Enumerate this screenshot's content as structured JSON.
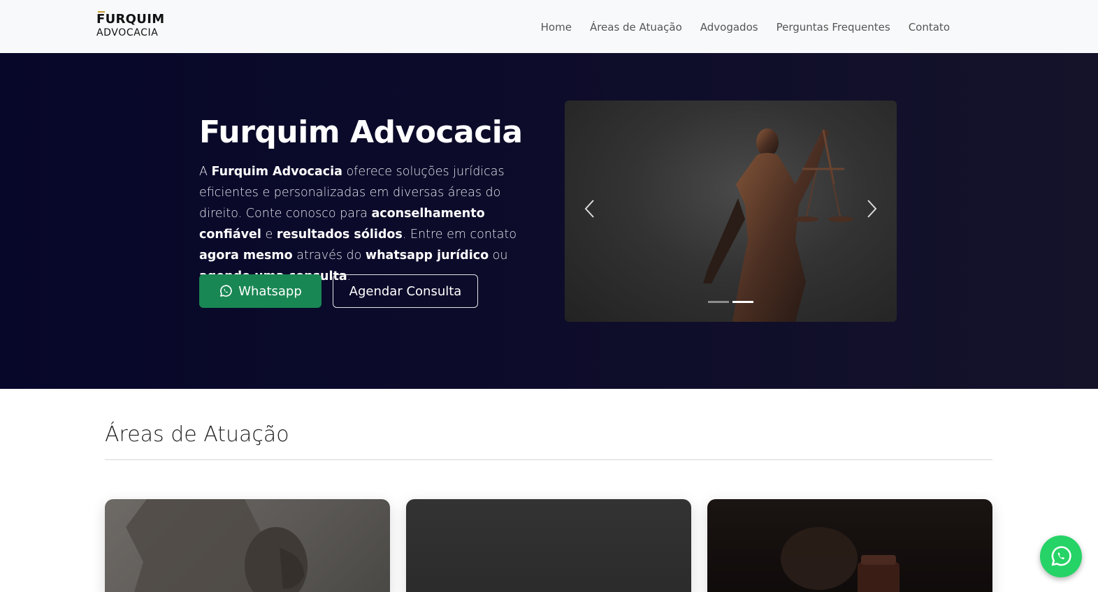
{
  "brand": {
    "line1": "FURQUIM",
    "line2": "ADVOCACIA"
  },
  "nav": {
    "items": [
      {
        "label": "Home"
      },
      {
        "label": "Áreas de Atuação"
      },
      {
        "label": "Advogados"
      },
      {
        "label": "Perguntas Frequentes"
      },
      {
        "label": "Contato"
      }
    ]
  },
  "hero": {
    "title": "Furquim Advocacia",
    "text_parts": {
      "p1": "A ",
      "b1": "Furquim Advocacia",
      "p2": " oferece soluções jurídicas eficientes e personalizadas em diversas áreas do direito. Conte conosco para ",
      "b2": "aconselhamento confiável",
      "p3": " e ",
      "b3": "resultados sólidos",
      "p4": ". Entre em contato ",
      "b4": "agora mesmo",
      "p5": " através do ",
      "b5": "whatsapp jurídico",
      "p6": " ou ",
      "b6": "agende uma consulta",
      "p7": "."
    },
    "whatsapp_label": "Whatsapp",
    "agendar_label": "Agendar Consulta"
  },
  "carousel": {
    "slide_count": 2,
    "active_index": 1
  },
  "areas": {
    "title": "Áreas de Atuação"
  },
  "colors": {
    "hero_bg": "#0d0c2a",
    "whatsapp_green": "#198754",
    "fab_green": "#25d366",
    "navbar_bg": "#f8f9fa"
  },
  "icons": [
    "whatsapp-icon",
    "chevron-left-icon",
    "chevron-right-icon"
  ]
}
